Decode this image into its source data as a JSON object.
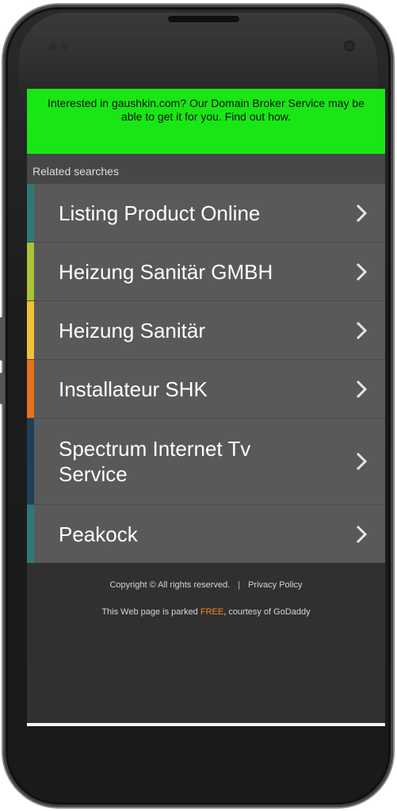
{
  "banner": {
    "text": "Interested in gaushkin.com? Our Domain Broker Service may be able to get it for you. Find out how.",
    "bg_color": "#19e615"
  },
  "related": {
    "title": "Related searches"
  },
  "items": [
    {
      "label": "Listing Product Online",
      "color": "#2c7a78",
      "icon": "chevron-right-icon"
    },
    {
      "label": "Heizung Sanitär GMBH",
      "color": "#a8c437",
      "icon": "chevron-right-icon"
    },
    {
      "label": "Heizung Sanitär",
      "color": "#f1c232",
      "icon": "chevron-right-icon"
    },
    {
      "label": "Installateur SHK",
      "color": "#e8731c",
      "icon": "chevron-right-icon"
    },
    {
      "label": "Spectrum Internet Tv Service",
      "color": "#1e3f5a",
      "icon": "chevron-right-icon"
    },
    {
      "label": "Peakock",
      "color": "#2c7a78",
      "icon": "chevron-right-icon"
    }
  ],
  "footer": {
    "copyright": "Copyright © All rights reserved.",
    "separator": "|",
    "privacy": "Privacy Policy",
    "parked_prefix": "This Web page is parked ",
    "parked_free": "FREE",
    "parked_suffix": ", courtesy of GoDaddy",
    "free_color": "#f0882b"
  }
}
